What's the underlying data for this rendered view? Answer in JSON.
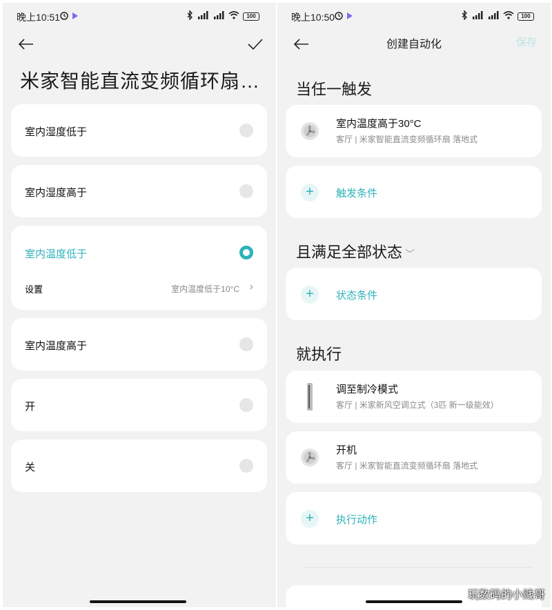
{
  "left": {
    "status": {
      "time": "晚上10:51",
      "signal": "HD",
      "battery": "100"
    },
    "title": "米家智能直流变频循环扇…",
    "options": [
      {
        "label": "室内湿度低于",
        "selected": false
      },
      {
        "label": "室内湿度高于",
        "selected": false
      },
      {
        "label": "室内温度低于",
        "selected": true,
        "setting_label": "设置",
        "setting_value": "室内温度低于10°C"
      },
      {
        "label": "室内温度高于",
        "selected": false
      },
      {
        "label": "开",
        "selected": false
      },
      {
        "label": "关",
        "selected": false
      }
    ]
  },
  "right": {
    "status": {
      "time": "晚上10:50",
      "signal": "HD",
      "battery": "100"
    },
    "title": "创建自动化",
    "save_label": "保存",
    "sections": {
      "trigger": "当任一触发",
      "condition": "且满足全部状态",
      "action": "就执行"
    },
    "trigger_item": {
      "title": "室内温度高于30°C",
      "subtitle": "客厅 | 米家智能直流变频循环扇 落地式"
    },
    "add_trigger": "触发条件",
    "add_condition": "状态条件",
    "actions": [
      {
        "title": "调至制冷模式",
        "subtitle": "客厅 | 米家新风空调立式（3匹 新一级能效）"
      },
      {
        "title": "开机",
        "subtitle": "客厅 | 米家智能直流变频循环扇 落地式"
      }
    ],
    "add_action": "执行动作"
  },
  "watermark": "玩数码的小贱哥",
  "colors": {
    "accent": "#2fb2ba",
    "background": "#f2f2f2",
    "card": "#ffffff",
    "save_disabled": "#bfe3e6"
  },
  "icons": [
    "back-arrow-icon",
    "checkmark-icon",
    "chevron-right-icon",
    "chevron-down-icon",
    "plus-icon",
    "fan-icon",
    "air-conditioner-icon",
    "bluetooth-icon",
    "wifi-icon",
    "battery-icon",
    "alarm-icon"
  ]
}
